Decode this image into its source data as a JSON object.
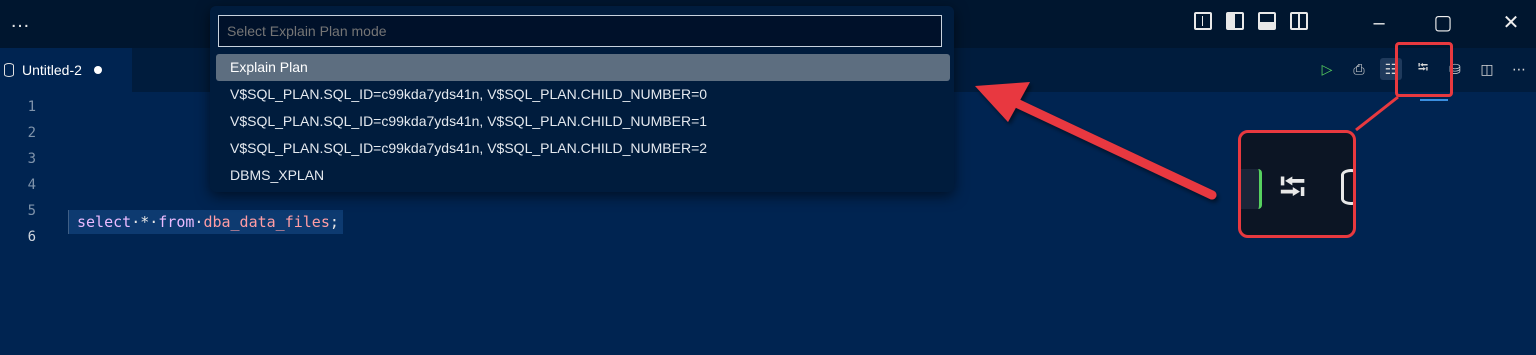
{
  "titlebar": {
    "menu_glyph": "…",
    "layout_icons": [
      "customize-layout-icon",
      "toggle-primary-sidebar-icon",
      "toggle-panel-icon",
      "toggle-secondary-sidebar-icon"
    ],
    "window_controls": {
      "minimize": "–",
      "maximize": "▢",
      "close": "✕"
    }
  },
  "editor_tab": {
    "label": "Untitled-2",
    "icon": "database-icon",
    "dirty": true
  },
  "editor_toolbar": {
    "buttons": [
      {
        "name": "run-query",
        "glyph": "▷"
      },
      {
        "name": "run-script",
        "glyph": "⎙"
      },
      {
        "name": "explain-plan-cached",
        "glyph": "☷"
      },
      {
        "name": "explain-plan",
        "glyph": "⭾"
      },
      {
        "name": "run-with-params",
        "glyph": "⛁"
      },
      {
        "name": "split-editor",
        "glyph": "◫"
      },
      {
        "name": "more-actions",
        "glyph": "⋯"
      }
    ]
  },
  "quick_pick": {
    "placeholder": "Select Explain Plan mode",
    "items": [
      "Explain Plan",
      "V$SQL_PLAN.SQL_ID=c99kda7yds41n, V$SQL_PLAN.CHILD_NUMBER=0",
      "V$SQL_PLAN.SQL_ID=c99kda7yds41n, V$SQL_PLAN.CHILD_NUMBER=1",
      "V$SQL_PLAN.SQL_ID=c99kda7yds41n, V$SQL_PLAN.CHILD_NUMBER=2",
      "DBMS_XPLAN"
    ],
    "selected_index": 0
  },
  "editor": {
    "line_numbers": [
      "1",
      "2",
      "3",
      "4",
      "5",
      "6"
    ],
    "active_line": 6,
    "code": {
      "kw1": "select",
      "star": "*",
      "kw2": "from",
      "table": "dba_data_files",
      "semi": ";"
    }
  },
  "annotation": {
    "color": "#e8393f",
    "zoomed_icon": "explain-plan-icon"
  }
}
